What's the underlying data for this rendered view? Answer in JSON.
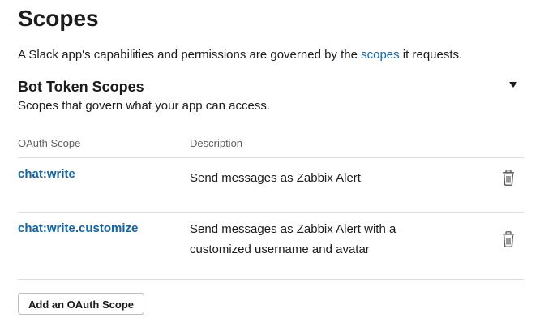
{
  "header": {
    "title": "Scopes",
    "intro_before": "A Slack app's capabilities and permissions are governed by the ",
    "intro_link": "scopes",
    "intro_after": " it requests."
  },
  "bot_token_section": {
    "title": "Bot Token Scopes",
    "subtitle": "Scopes that govern what your app can access.",
    "columns": {
      "scope": "OAuth Scope",
      "description": "Description"
    },
    "rows": [
      {
        "scope": "chat:write",
        "description_line1": "Send messages as Zabbix Alert",
        "description_line2": ""
      },
      {
        "scope": "chat:write.customize",
        "description_line1": "Send messages as Zabbix Alert with a",
        "description_line2": "customized username and avatar"
      }
    ],
    "add_button_label": "Add an OAuth Scope"
  },
  "icons": {
    "collapse": "caret-down-icon",
    "remove": "trash-icon"
  },
  "colors": {
    "link": "#1264a3",
    "text": "#1d1c1d",
    "muted": "#616061",
    "divider": "#dddddd"
  }
}
